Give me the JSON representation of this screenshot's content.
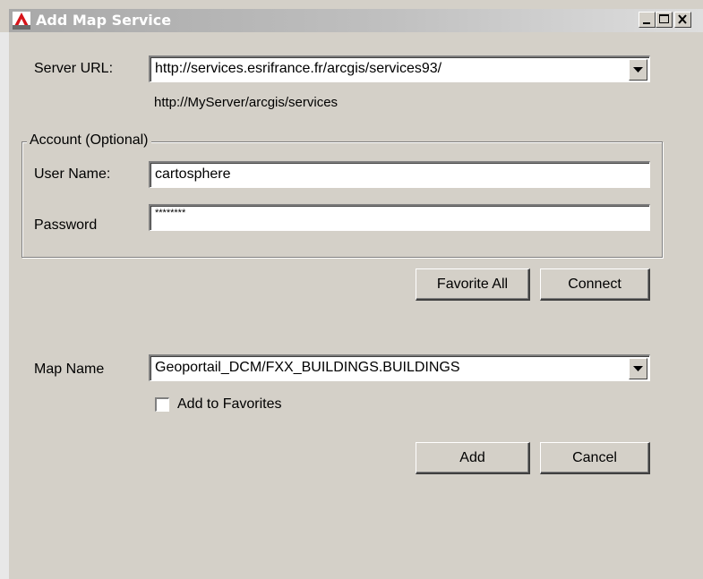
{
  "window": {
    "title": "Add Map Service",
    "icon": "autocad-a-icon",
    "controls": {
      "minimize": "minimize-icon",
      "maximize": "maximize-icon",
      "close": "close-icon"
    }
  },
  "server": {
    "label": "Server URL:",
    "value": "http://services.esrifrance.fr/arcgis/services93/",
    "hint": "http://MyServer/arcgis/services"
  },
  "account": {
    "legend": "Account (Optional)",
    "user_label": "User Name:",
    "user_value": "cartosphere",
    "password_label": "Password",
    "password_value": "********"
  },
  "buttons": {
    "favorite_all": "Favorite All",
    "connect": "Connect",
    "add": "Add",
    "cancel": "Cancel"
  },
  "map": {
    "label": "Map Name",
    "value": "Geoportail_DCM/FXX_BUILDINGS.BUILDINGS",
    "add_to_favorites_label": "Add to Favorites",
    "add_to_favorites_checked": false
  },
  "colors": {
    "dialog_bg": "#d4d0c8",
    "titlebar_inactive": "#a8a8a8",
    "icon_red": "#d7141a"
  }
}
